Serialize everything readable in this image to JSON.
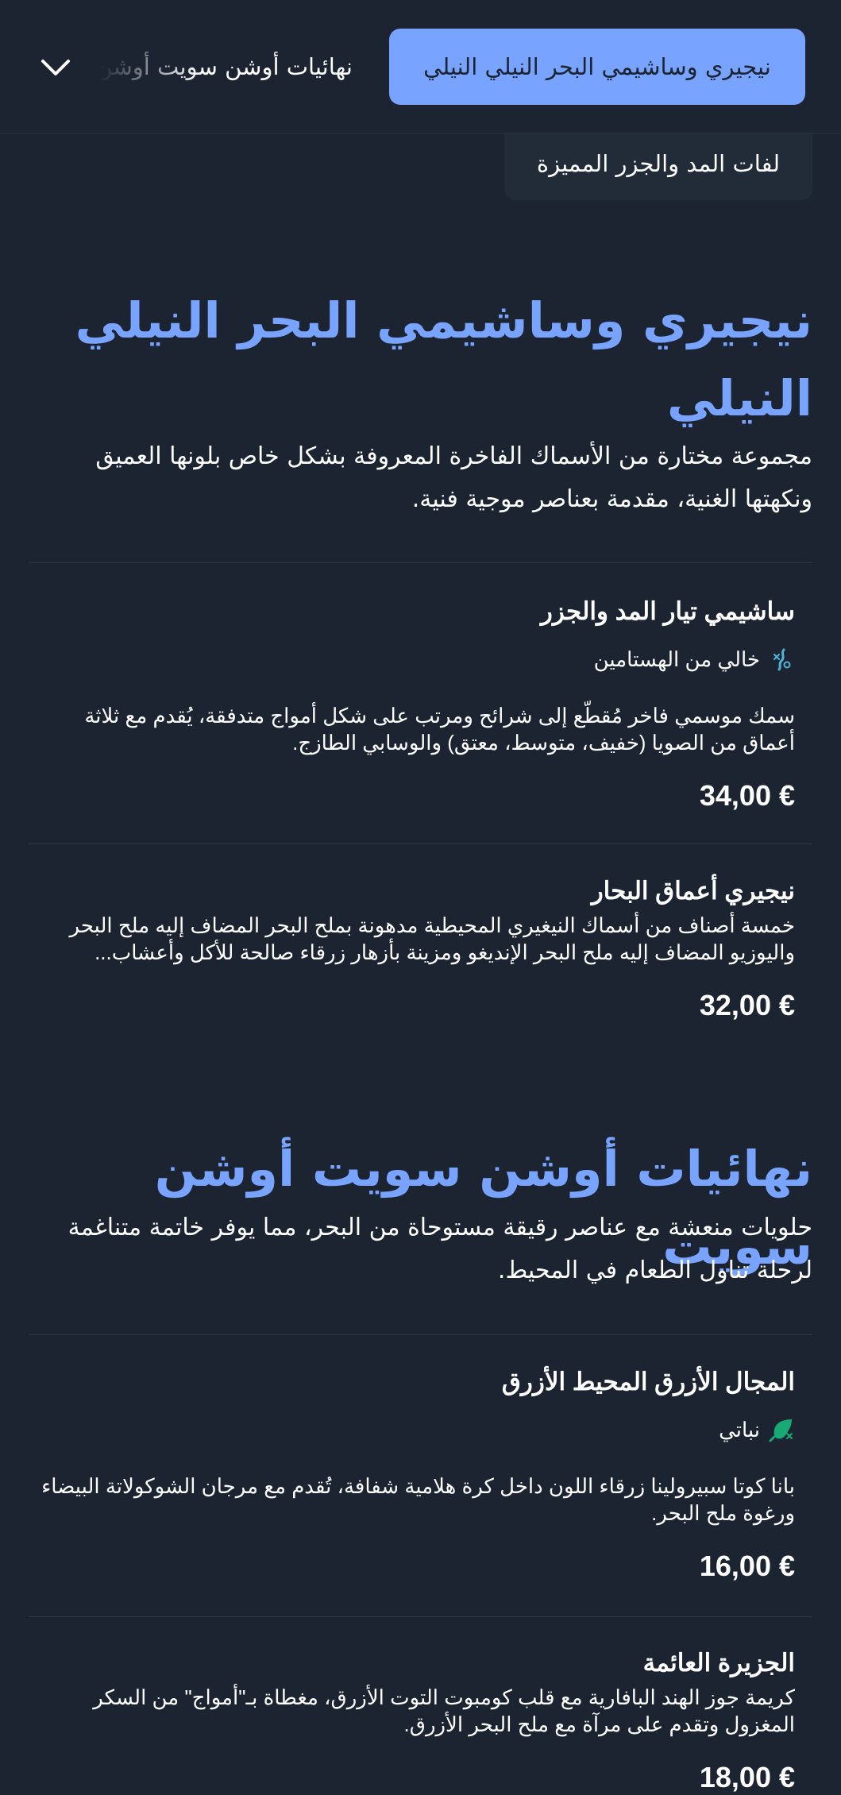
{
  "nav": {
    "active_category": "نيجيري وساشيمي البحر النيلي النيلي",
    "next_category": "نهائيات أوشن سويت أوشن سويت",
    "sub_category": "لفات المد والجزر المميزة",
    "expand_icon": "chevron-down-icon"
  },
  "sections": [
    {
      "title": "نيجيري وساشيمي البحر النيلي النيلي",
      "description": "مجموعة مختارة من الأسماك الفاخرة المعروفة بشكل خاص بلونها العميق ونكهتها الغنية، مقدمة بعناصر موجية فنية.",
      "items": [
        {
          "name": "ساشيمي تيار المد والجزر",
          "tag": "خالي من الهستامين",
          "tag_icon": "histamine-free-icon",
          "description": "سمك موسمي فاخر مُقطّع إلى شرائح ومرتب على شكل أمواج متدفقة، يُقدم مع ثلاثة أعماق من الصويا (خفيف، متوسط، معتق) والوسابي الطازج.",
          "price": "34,00 €"
        },
        {
          "name": "نيجيري أعماق البحار",
          "description": "خمسة أصناف من أسماك النيغيري المحيطية مدهونة بملح البحر المضاف إليه ملح البحر واليوزيو المضاف إليه ملح البحر الإنديغو ومزينة بأزهار زرقاء صالحة للأكل وأعشاب...",
          "price": "32,00 €"
        }
      ]
    },
    {
      "title": "نهائيات أوشن سويت أوشن سويت",
      "description": "حلويات منعشة مع عناصر رقيقة مستوحاة من البحر، مما يوفر خاتمة متناغمة لرحلة تناول الطعام في المحيط.",
      "items": [
        {
          "name": "المجال الأزرق المحيط الأزرق",
          "tag": "نباتي",
          "tag_icon": "vegan-leaf-icon",
          "description": "بانا كوتا سبيرولينا زرقاء اللون داخل كرة هلامية شفافة، تُقدم مع مرجان الشوكولاتة البيضاء ورغوة ملح البحر.",
          "price": "16,00 €"
        },
        {
          "name": "الجزيرة العائمة",
          "description": "كريمة جوز الهند البافارية مع قلب كومبوت التوت الأزرق، مغطاة بـ\"أمواج\" من السكر المغزول وتقدم على مرآة مع ملح البحر الأزرق.",
          "price": "18,00 €"
        }
      ]
    }
  ],
  "colors": {
    "background": "#1b2430",
    "accent": "#78a3ff",
    "divider": "#2d3846",
    "histamine_icon": "#4fb3d9",
    "vegan_icon": "#19a974"
  }
}
